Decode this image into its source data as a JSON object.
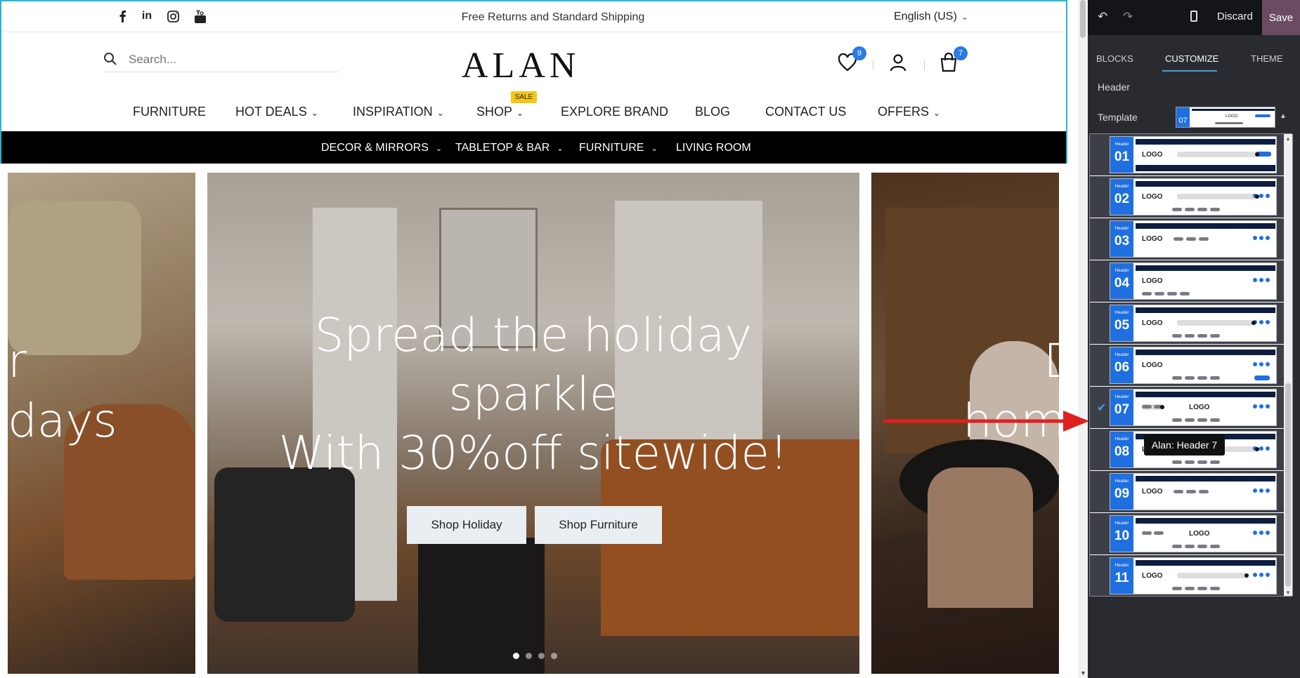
{
  "topbar": {
    "social": [
      "facebook-icon",
      "linkedin-icon",
      "instagram-icon",
      "youtube-icon"
    ],
    "promo_text": "Free Returns and Standard Shipping",
    "language": "English (US)"
  },
  "search": {
    "placeholder": "Search..."
  },
  "logo": "ALAN",
  "icons": {
    "wishlist_count": "9",
    "cart_count": "7"
  },
  "main_nav": {
    "furniture": "FURNITURE",
    "hot_deals": "HOT DEALS",
    "inspiration": "INSPIRATION",
    "shop": "SHOP",
    "sale_tag": "SALE",
    "explore_brand": "EXPLORE BRAND",
    "blog": "BLOG",
    "contact_us": "CONTACT US",
    "offers": "OFFERS"
  },
  "sub_nav": {
    "decor": "DECOR & MIRRORS",
    "tabletop": "TABLETOP & BAR",
    "furniture": "FURNITURE",
    "living_room": "LIVING ROOM"
  },
  "hero": {
    "line1": "Spread the holiday",
    "line2": "sparkle",
    "line3": "With 30%off sitewide!",
    "button_holiday": "Shop Holiday",
    "button_furniture": "Shop Furniture",
    "left_fragment_1": "r",
    "left_fragment_2": "days",
    "right_fragment_1": "D",
    "right_fragment_2": "hom"
  },
  "editor": {
    "discard": "Discard",
    "save": "Save",
    "tabs": {
      "blocks": "BLOCKS",
      "customize": "CUSTOMIZE",
      "theme": "THEME"
    },
    "section_title": "Header",
    "template_label": "Template",
    "current_template": "07",
    "tooltip": "Alan: Header 7",
    "card_header_word": "Header",
    "card_logo_word": "LOGO",
    "templates": [
      "01",
      "02",
      "03",
      "04",
      "05",
      "06",
      "07",
      "08",
      "09",
      "10",
      "11"
    ],
    "selected_template": "07"
  },
  "colors": {
    "accent_blue": "#1f6fe0",
    "badge_blue": "#2a7be4",
    "sale_yellow": "#f5c518",
    "save_purple": "#6a4c62",
    "header_frame": "#24b5d6",
    "arrow_red": "#e02020"
  }
}
